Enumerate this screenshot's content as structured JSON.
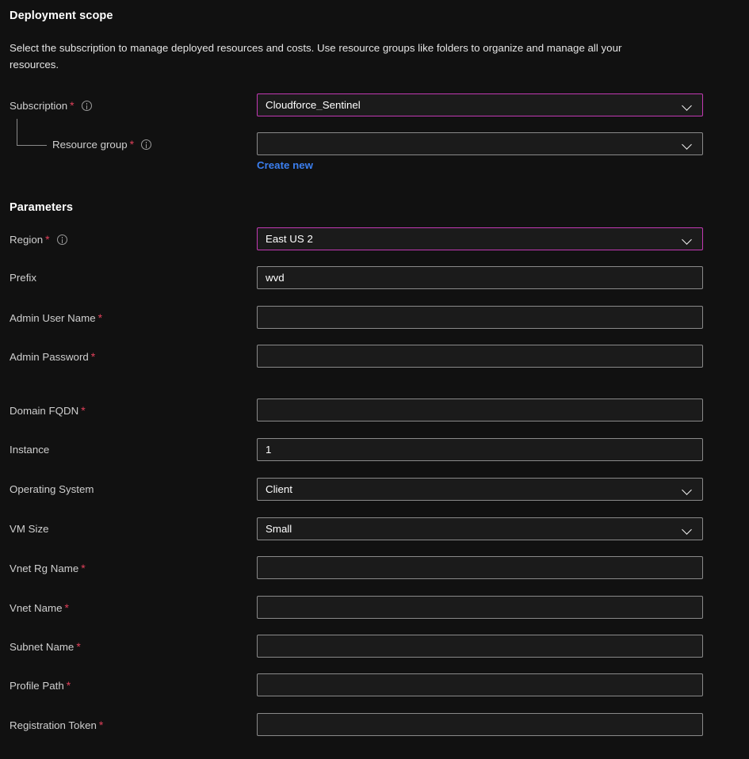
{
  "colors": {
    "background": "#111111",
    "field_border": "#8a8a8a",
    "field_focus_border": "#c239b3",
    "required_asterisk": "#e0405a",
    "link": "#3b7ff0",
    "label_text": "#cfcfcf",
    "value_text": "#ffffff"
  },
  "deployment_scope": {
    "title": "Deployment scope",
    "description": "Select the subscription to manage deployed resources and costs. Use resource groups like folders to organize and manage all your resources.",
    "subscription": {
      "label": "Subscription",
      "required": "*",
      "value": "Cloudforce_Sentinel"
    },
    "resource_group": {
      "label": "Resource group",
      "required": "*",
      "value": "",
      "create_new_link": "Create new"
    }
  },
  "parameters": {
    "title": "Parameters",
    "fields": [
      {
        "label": "Region",
        "required": "*",
        "value": "East US 2",
        "type": "dropdown",
        "info": true,
        "focused": true
      },
      {
        "label": "Prefix",
        "required": "",
        "value": "wvd",
        "type": "text",
        "info": false,
        "focused": false
      },
      {
        "label": "Admin User Name",
        "required": "*",
        "value": "",
        "type": "text",
        "info": false,
        "focused": false
      },
      {
        "label": "Admin Password",
        "required": "*",
        "value": "",
        "type": "text",
        "info": false,
        "focused": false
      },
      {
        "label": "Domain FQDN",
        "required": "*",
        "value": "",
        "type": "text",
        "info": false,
        "focused": false
      },
      {
        "label": "Instance",
        "required": "",
        "value": "1",
        "type": "text",
        "info": false,
        "focused": false
      },
      {
        "label": "Operating System",
        "required": "",
        "value": "Client",
        "type": "dropdown",
        "info": false,
        "focused": false
      },
      {
        "label": "VM Size",
        "required": "",
        "value": "Small",
        "type": "dropdown",
        "info": false,
        "focused": false
      },
      {
        "label": "Vnet Rg Name",
        "required": "*",
        "value": "",
        "type": "text",
        "info": false,
        "focused": false
      },
      {
        "label": "Vnet Name",
        "required": "*",
        "value": "",
        "type": "text",
        "info": false,
        "focused": false
      },
      {
        "label": "Subnet Name",
        "required": "*",
        "value": "",
        "type": "text",
        "info": false,
        "focused": false
      },
      {
        "label": "Profile Path",
        "required": "*",
        "value": "",
        "type": "text",
        "info": false,
        "focused": false
      },
      {
        "label": "Registration Token",
        "required": "*",
        "value": "",
        "type": "text",
        "info": false,
        "focused": false
      }
    ]
  }
}
